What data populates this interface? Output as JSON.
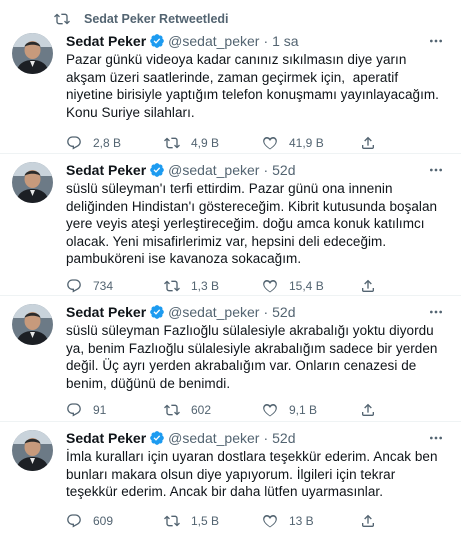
{
  "retweet_label": "Sedat Peker Retweetledi",
  "tweets": [
    {
      "name": "Sedat Peker",
      "handle": "@sedat_peker",
      "dot": "·",
      "time": "1 sa",
      "text": "Pazar günkü videoya kadar canınız sıkılmasın diye yarın akşam üzeri saatlerinde, zaman geçirmek için,  aperatif niyetine birisiyle yaptığım telefon konuşmamı yayınlayacağım. Konu Suriye silahları.",
      "replies": "2,8 B",
      "retweets": "4,9 B",
      "likes": "41,9 B"
    },
    {
      "name": "Sedat Peker",
      "handle": "@sedat_peker",
      "dot": "·",
      "time": "52d",
      "text": "süslü süleyman'ı terfi ettirdim. Pazar günü ona innenin deliğinden Hindistan'ı göstereceğim. Kibrit kutusunda boşalan yere veyis ateşi yerleştireceğim. doğu amca konuk katılımcı olacak. Yeni misafirlerimiz var, hepsini deli edeceğim. pambuköreni ise kavanoza sokacağım.",
      "replies": "734",
      "retweets": "1,3 B",
      "likes": "15,4 B"
    },
    {
      "name": "Sedat Peker",
      "handle": "@sedat_peker",
      "dot": "·",
      "time": "52d",
      "text": "süslü süleyman Fazlıoğlu sülalesiyle akrabalığı yoktu diyordu ya, benim Fazlıoğlu sülalesiyle akrabalığım sadece bir yerden değil. Üç ayrı yerden akrabalığım var. Onların cenazesi de benim, düğünü de benimdi.",
      "replies": "91",
      "retweets": "602",
      "likes": "9,1 B"
    },
    {
      "name": "Sedat Peker",
      "handle": "@sedat_peker",
      "dot": "·",
      "time": "52d",
      "text": "İmla kuralları için uyaran dostlara teşekkür ederim. Ancak ben bunları makara olsun diye yapıyorum. İlgileri için tekrar teşekkür ederim. Ancak bir daha lütfen uyarmasınlar.",
      "replies": "609",
      "retweets": "1,5 B",
      "likes": "13 B"
    }
  ],
  "colors": {
    "verified": "#1d9bf0",
    "secondary_text": "#536471",
    "divider": "#eff3f4"
  },
  "icons": [
    "retweet-icon",
    "verified-badge-icon",
    "more-options-icon",
    "reply-icon",
    "like-icon",
    "share-icon"
  ]
}
